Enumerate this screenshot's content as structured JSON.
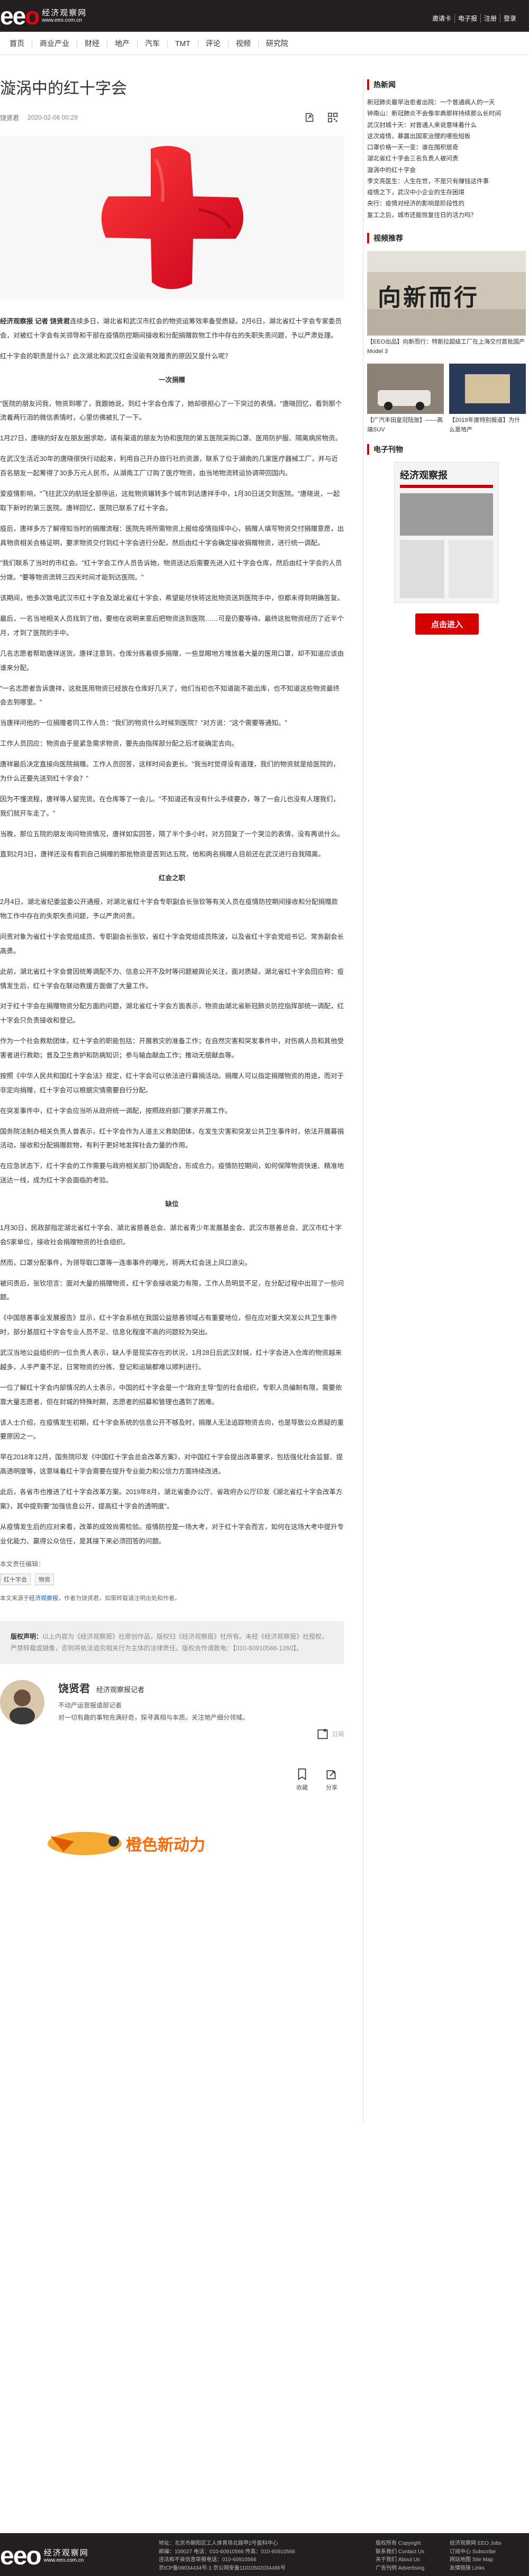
{
  "header": {
    "logo_main": "eeo",
    "logo_cn": "经济观察网",
    "logo_url": "www.eeo.com.cn",
    "links": [
      "邀请卡",
      "电子报",
      "注册",
      "登录"
    ]
  },
  "nav": [
    "首页",
    "商业产业",
    "财经",
    "地产",
    "汽车",
    "TMT",
    "评论",
    "视频",
    "研究院"
  ],
  "article": {
    "title": "漩涡中的红十字会",
    "author": "饶贤君",
    "date": "2020-02-06 00:29",
    "paragraphs": [
      {
        "lead": "经济观察报 记者 饶贤君",
        "text": "连续多日，湖北省和武汉市红会的物资运筹效率备受质疑。2月6日，湖北省红十字会专家委员会，对被红十字会有关领导和干部在疫情防控期间接收和分配捐赠款物工作中存在的失职失责问题，予以严肃处理。"
      },
      {
        "text": "红十字会的职责是什么？此次湖北和武汉红会没能有效履责的原因又是什么呢？"
      },
      {
        "sub": "一次捐赠"
      },
      {
        "text": "\"医院的朋友问我，物资到哪了，我跟她说，到红十字会仓库了，她却很担心了一下突过的表情。\"唐晓回忆，看到那个流着两行泪的微信表情时，心里仿佛被扎了一下。"
      },
      {
        "text": "1月27日，唐晓的好友在朋友圈求助，请有渠道的朋友为协和医院的第五医院采购口罩、医用防护服、隔离病房物资。"
      },
      {
        "text": "在武汉生活近30年的唐晓很快行动起来，利用自己开办旅行社的资源，联系了位于湖南的几家医疗器械工厂，并与近百名朋友一起筹得了30多万元人民币。从湖南工厂订购了医疗物资，由当地物流转运协调带回国内。"
      },
      {
        "text": "爱疫情影响，\"飞往武汉的航班全部停运，这批物资辗转多个城市到达唐祥手中，1月30日送交到医院。\"唐晓说，一起取下新时的第三医院。唐祥回忆，医院已联系了红十字会。"
      },
      {
        "text": "疫后，唐祥多方了解得知当时的捐赠流程：医院先将所需物资上报给疫情指挥中心，捐赠人填写物资交付捐赠意愿，出具物资相关合格证明，要求物资交付到红十字会进行分配，然后由红十字会确定接收捐赠物资，进行统一调配。"
      },
      {
        "text": "\"我们联系了当时的市红会。\"红十字会工作人员告诉她，物资送达后需要先进入红十字会仓库，然后由红十字会的人员分拨。\"要等物资流转三四天时间才能到达医院。\""
      },
      {
        "text": "该期间，他多次致电武汉市红十字会及湖北省红十字会，希望能尽快将这批物资送到医院手中，但都未得到明确答复。"
      },
      {
        "text": "最后，一名当地相关人员找到了他，要他在说明来意后把物资送到医院……可是仍要等待。最终这批物资经历了近半个月，才到了医院的手中。"
      },
      {
        "text": "几名志愿者帮助唐祥送货。唐祥注意到，仓库分拣着很多捐赠，一些显眼地方堆放着大量的医用口罩，却不知道应该由谁来分配。"
      },
      {
        "text": "\"一名志愿者告诉唐祥，这批医用物资已经放在仓库好几天了，他们当初也不知道能不能出库，也不知道这些物资最终会去到哪里。\""
      },
      {
        "text": "当唐祥问他的一位捐赠者同工作人员：\"我们的物资什么时候到医院？\"对方说：\"这个需要等通知。\""
      },
      {
        "text": "工作人员回应：物资由于是紧急需求物资，要先由指挥部分配之后才能确定去向。"
      },
      {
        "text": "唐祥最后决定直接向医院捐赠。工作人员回答，这样时间会更长。\"我当时觉得没有道理，我们的物资就是给医院的，为什么还要先送到红十字会？\""
      },
      {
        "text": "因为不懂流程，唐祥等人留完货。在仓库等了一会儿。\"不知道还有没有什么手续要办，等了一会儿也没有人理我们，我们就开车走了。\""
      },
      {
        "text": "当晚，那位五院的朋友询问物资情况，唐祥如实回答，隔了半个多小时，对方回复了一个哭泣的表情，没有再说什么。"
      },
      {
        "text": "直到2月3日，唐祥还没有看到自己捐赠的那批物资是否到达五院，他和两名捐赠人目前还在武汉进行自我隔离。"
      },
      {
        "sub": "红会之职"
      },
      {
        "text": "2月4日，湖北省纪委监委公开通报，对湖北省红十字会专职副会长张钦等有关人员在疫情防控期间接收和分配捐赠款物工作中存在的失职失责问题，予以严肃问责。"
      },
      {
        "text": "问责对象为省红十字会党组成员、专职副会长张钦，省红十字会党组成员陈波，以及省红十字会党组书记、常务副会长高勇。"
      },
      {
        "text": "此前，湖北省红十字会曾因统筹调配不力、信息公开不及时等问题被舆论关注，面对质疑，湖北省红十字会回应称：疫情发生后，红十字会在联动救援方面做了大量工作。"
      },
      {
        "text": "对于红十字会在捐赠物资分配方面的问题，湖北省红十字会方面表示，物资由湖北省新冠肺炎防控指挥部统一调配，红十字会只负责接收和登记。"
      },
      {
        "text": "作为一个社会救助团体，红十字会的职能包括：开展救灾的准备工作；在自然灾害和突发事件中，对伤病人员和其他受害者进行救助；普及卫生救护和防病知识；参与输血献血工作；推动无偿献血等。"
      },
      {
        "text": "按照《中华人民共和国红十字会法》规定，红十字会可以依法进行募捐活动。捐赠人可以指定捐赠物资的用途，而对于非定向捐赠，红十字会可以根据灾情需要自行分配。"
      },
      {
        "text": "在突发事件中，红十字会应当听从政府统一调配，按照政府部门要求开展工作。"
      },
      {
        "text": "国务院法制办相关负责人曾表示，红十字会作为人道主义救助团体，在发生灾害和突发公共卫生事件时，依法开展募捐活动，接收和分配捐赠款物，有利于更好地发挥社会力量的作用。"
      },
      {
        "text": "在应急状态下，红十字会的工作需要与政府相关部门协调配合，形成合力。疫情防控期间，如何保障物资快速、精准地送达一线，成为红十字会面临的考验。"
      },
      {
        "sub": "缺位"
      },
      {
        "text": "1月30日，民政部指定湖北省红十字会、湖北省慈善总会、湖北省青少年发展基金会、武汉市慈善总会、武汉市红十字会5家单位，接收社会捐赠物资的社会组织。"
      },
      {
        "text": "然而，口罩分配事件，为领导取口罩等一连串事件的曝光，将两大红会送上风口浪尖。"
      },
      {
        "text": "被问责后，张钦坦言：面对大量的捐赠物资，红十字会接收能力有限，工作人员明显不足，在分配过程中出现了一些问题。"
      },
      {
        "text": "《中国慈善事业发展报告》显示，红十字会系统在我国公益慈善领域占有重要地位，但在应对重大突发公共卫生事件时，部分基层红十字会专业人员不足、信息化程度不高的问题较为突出。"
      },
      {
        "text": "武汉当地公益组织的一位负责人表示，缺人手是现实存在的状况，1月28日后武汉封城，红十字会进入仓库的物资越来越多，人手严重不足，日常物资的分拣、登记和运输都难以顺利进行。"
      },
      {
        "text": "一位了解红十字会内部情况的人士表示，中国的红十字会是一个\"政府主导\"型的社会组织，专职人员编制有限，需要依靠大量志愿者，但在封城的特殊时期，志愿者的招募和管理也遇到了困难。"
      },
      {
        "text": "该人士介绍，在疫情发生初期，红十字会系统的信息公开不够及时，捐赠人无法追踪物资去向，也是导致公众质疑的重要原因之一。"
      },
      {
        "text": "早在2018年12月，国务院印发《中国红十字会总会改革方案》，对中国红十字会提出改革要求，包括强化社会监督、提高透明度等，这意味着红十字会需要在提升专业能力和公信力方面持续改进。"
      },
      {
        "text": "此后，各省市也推进了红十字会改革方案。2019年8月，湖北省委办公厅、省政府办公厅印发《湖北省红十字会改革方案》，其中提到要\"加强信息公开，提高红十字会的透明度\"。"
      },
      {
        "text": "从疫情发生后的应对来看，改革的成效尚需检验。疫情防控是一场大考，对于红十字会而言，如何在这场大考中提升专业化能力、赢得公众信任，是其接下来必须回答的问题。"
      }
    ],
    "source_line": "本文责任编辑：",
    "tags": [
      "红十字会",
      "物资"
    ],
    "note_prefix": "本文来源于",
    "note_source": "经济观察报",
    "note_suffix": "，作者为饶贤君，如需转载请注明出处和作者。",
    "editor": "责任编辑"
  },
  "copyright": {
    "label": "版权声明：",
    "text": "以上内容为《经济观察报》社原创作品，版权归《经济观察报》社所有。未经《经济观察报》社授权，严禁转载或镜像，否则将依法追究相关行为主体的法律责任。版权合作请致电：【010-60910566-1260】。"
  },
  "author_card": {
    "name": "饶贤君",
    "role": "经济观察报记者",
    "desc_1": "不动产运营报道部记者",
    "desc_2": "对一切有趣的事物充满好奇，探寻真相与本质。关注地产细分领域。",
    "follow": "订阅"
  },
  "actions": {
    "collect": "收藏",
    "share": "分享"
  },
  "banner": {
    "text": "橙色新动力"
  },
  "sidebar": {
    "hot_title": "热新闻",
    "hot_items": [
      "新冠肺炎最早治愈者出院：一个普通病人的一天",
      "钟南山：新冠肺炎不会像非典那样持续那么长时间",
      "武汉封城十天：对普通人来说意味着什么",
      "这次疫情，暴露出国家治理的哪些短板",
      "口罩价格一天一变：谁在囤积居奇",
      "湖北省红十字会三名负责人被问责",
      "漩涡中的红十字会",
      "李文亮医生：人生在世，不是只有赚钱这件事",
      "疫情之下，武汉中小企业的生存困境",
      "央行：疫情对经济的影响是阶段性的",
      "复工之后，城市还能恢复往日的活力吗？"
    ],
    "video_title": "视频推荐",
    "video_big_caption": "【EEO出品】向新而行：特斯拉超级工厂在上海交付首批国产Model 3",
    "video_big_text": "向新而行",
    "video_small": [
      {
        "caption": "【广汽丰田皇冠陆放】——高端SUV"
      },
      {
        "caption": "【2019年度特别报道】为什么是地产"
      }
    ],
    "paper_title": "电子刊物",
    "paper_name": "经济观察报",
    "enter": "点击进入"
  },
  "footer": {
    "logo": "eeo",
    "cn": "经济观察网",
    "url": "www.eeo.com.cn",
    "info": [
      "地址：北京市朝阳区工人体育场北路甲2号盈科中心",
      "邮编：100027  电话：010-60910566  传真：010-60910566",
      "违法和不良信息举报电话：010-60910566",
      "京ICP备09034434号-1  京公网安备11010502034486号"
    ],
    "col1": [
      "版权所有 Copyright",
      "联系我们 Contact Us",
      "关于我们 About Us",
      "广告刊例 Advertising"
    ],
    "col2": [
      "经济观察网 EEO Jobs",
      "订阅中心 Subscribe",
      "网站地图 Site Map",
      "友情链接 Links"
    ]
  }
}
